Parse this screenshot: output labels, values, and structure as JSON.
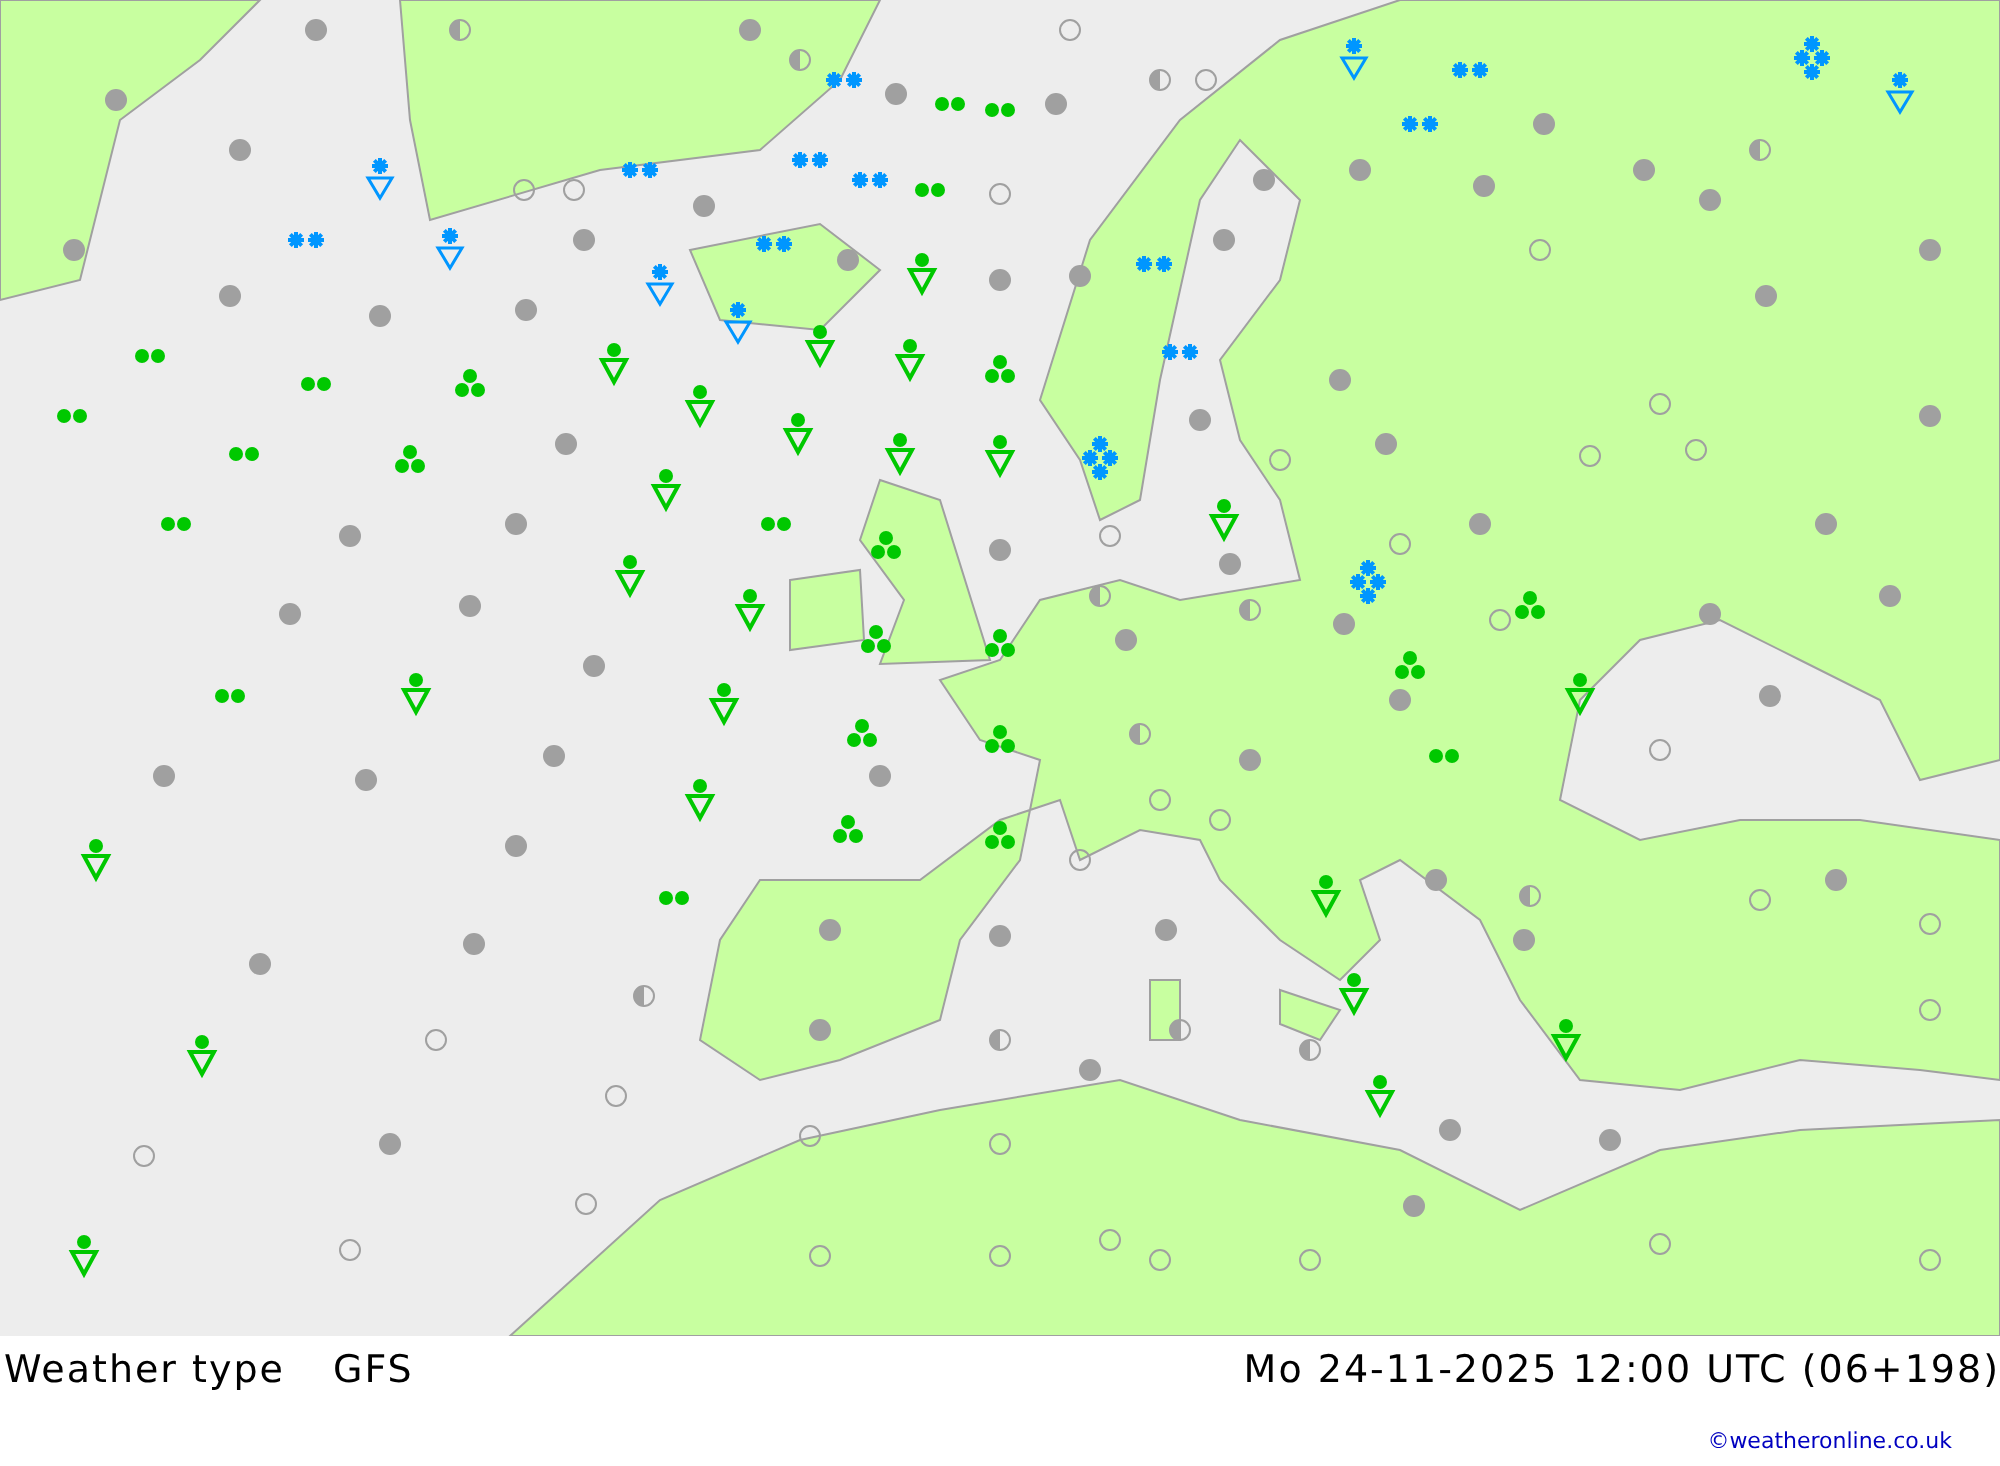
{
  "map": {
    "title": "Weather type",
    "model": "GFS",
    "valid_time": "Mo 24-11-2025 12:00 UTC (06+198)"
  },
  "credit": "©weatheronline.co.uk"
}
